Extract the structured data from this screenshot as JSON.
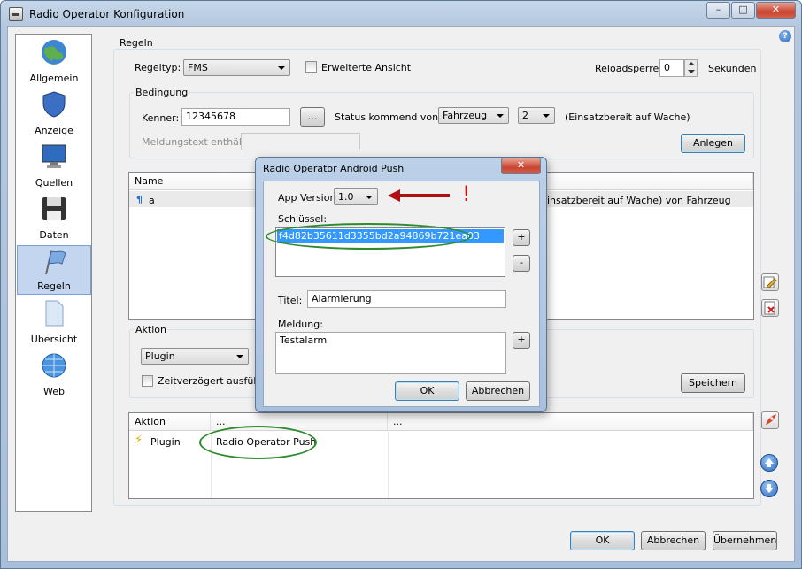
{
  "window": {
    "title": "Radio Operator Konfiguration",
    "help": "?"
  },
  "nav": {
    "items": [
      {
        "label": "Allgemein"
      },
      {
        "label": "Anzeige"
      },
      {
        "label": "Quellen"
      },
      {
        "label": "Daten"
      },
      {
        "label": "Regeln"
      },
      {
        "label": "Übersicht"
      },
      {
        "label": "Web"
      }
    ]
  },
  "regeln": {
    "group_label": "Regeln",
    "regeltyp_label": "Regeltyp:",
    "regeltyp_value": "FMS",
    "erweiterte_label": "Erweiterte Ansicht",
    "reload_label": "Reloadsperre:",
    "reload_value": "0",
    "sekunden_label": "Sekunden"
  },
  "bedingung": {
    "group_label": "Bedingung",
    "kenner_label": "Kenner:",
    "kenner_value": "12345678",
    "ellipsis": "...",
    "status_label": "Status kommend von:",
    "status_source": "Fahrzeug",
    "status_value": "2",
    "status_desc": "(Einsatzbereit auf Wache)",
    "meldung_label": "Meldungstext enthält:",
    "anlegen": "Anlegen"
  },
  "rules_list": {
    "col_name": "Name",
    "row_name": "a",
    "row_desc": "insatzbereit auf Wache) von Fahrzeug"
  },
  "aktion": {
    "group_label": "Aktion",
    "type_value": "Plugin",
    "delay_label": "Zeitverzögert ausführen",
    "speichern": "Speichern"
  },
  "actions_list": {
    "col1": "Aktion",
    "col2": "...",
    "col3": "...",
    "row_type": "Plugin",
    "row_value": "Radio Operator Push"
  },
  "footer": {
    "ok": "OK",
    "abbrechen": "Abbrechen",
    "uebernehmen": "Übernehmen"
  },
  "dialog": {
    "title": "Radio Operator Android Push",
    "app_version_label": "App Version:",
    "app_version_value": "1.0",
    "exclamation": "!",
    "schluessel_label": "Schlüssel:",
    "schluessel_value": "f4d82b35611d3355bd2a94869b721ea03",
    "plus": "+",
    "minus": "-",
    "titel_label": "Titel:",
    "titel_value": "Alarmierung",
    "meldung_label": "Meldung:",
    "meldung_value": "Testalarm",
    "ok": "OK",
    "abbrechen": "Abbrechen"
  },
  "colors": {
    "accent": "#3c7fb1",
    "selection": "#3399ff",
    "highlight_ellipse": "#2d8a2d",
    "arrow": "#b01010"
  }
}
